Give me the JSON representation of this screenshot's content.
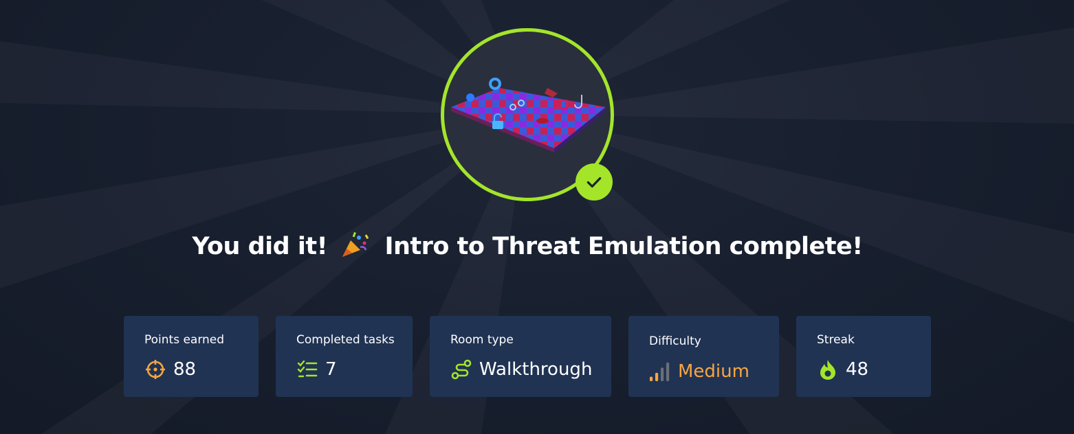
{
  "headline": {
    "prefix": "You did it!",
    "emoji_icon": "party-popper-icon",
    "suffix": "Intro to Threat Emulation complete!"
  },
  "badge": {
    "art": "checkerboard-room-badge",
    "status_icon": "checkmark-icon",
    "ring_color": "#a4e52a"
  },
  "stats": [
    {
      "label": "Points earned",
      "value": "88",
      "icon": "crosshair-icon",
      "icon_color": "#f6a641"
    },
    {
      "label": "Completed tasks",
      "value": "7",
      "icon": "task-list-icon",
      "icon_color": "#a4e52a"
    },
    {
      "label": "Room type",
      "value": "Walkthrough",
      "icon": "route-icon",
      "icon_color": "#a4e52a"
    },
    {
      "label": "Difficulty",
      "value": "Medium",
      "icon": "signal-bars-icon",
      "icon_color": "#f6a641"
    },
    {
      "label": "Streak",
      "value": "48",
      "icon": "flame-icon",
      "icon_color": "#a4e52a"
    }
  ],
  "colors": {
    "background": "#161d2c",
    "card": "#213353",
    "accent_green": "#a4e52a",
    "accent_orange": "#f6a641"
  }
}
